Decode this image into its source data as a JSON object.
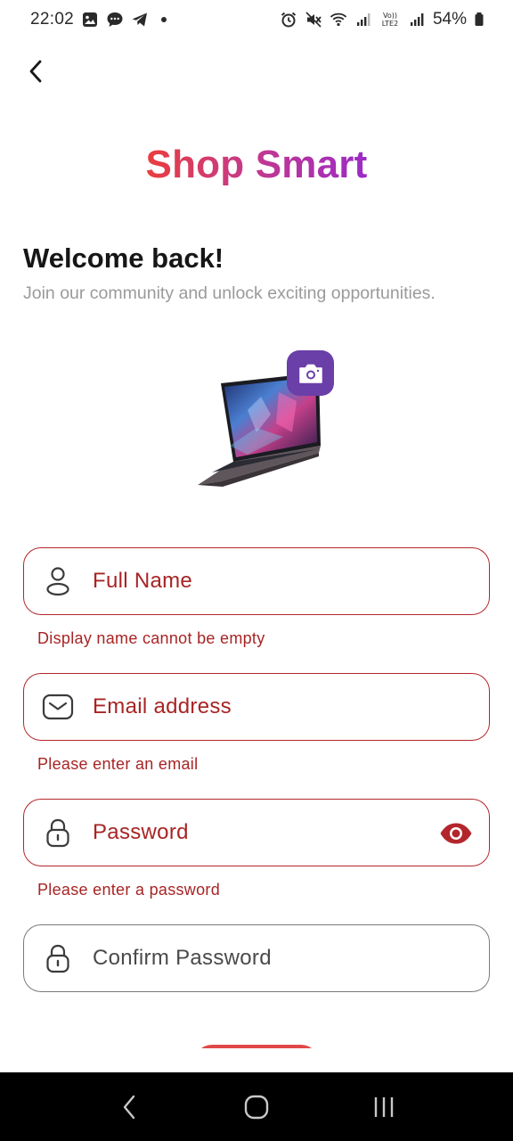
{
  "status_bar": {
    "time": "22:02",
    "left_icons": [
      "image-icon",
      "chat-icon",
      "telegram-icon"
    ],
    "right_icons": [
      "alarm-icon",
      "mute-icon",
      "wifi-icon",
      "signal-icon",
      "volte-icon",
      "signal-icon"
    ],
    "volte_label_top": "Vo))",
    "volte_label_bottom": "LTE2",
    "battery": "54%"
  },
  "header": {
    "back_icon": "chevron-left-icon"
  },
  "brand": {
    "title": "Shop Smart",
    "gradient_start": "#ea3d3d",
    "gradient_end": "#9b2bc6"
  },
  "intro": {
    "heading": "Welcome back!",
    "subtitle": "Join our community and unlock exciting opportunities."
  },
  "product": {
    "image": "laptop-image",
    "camera_icon": "camera-icon",
    "camera_bg": "#6a3fa8"
  },
  "form": {
    "full_name": {
      "placeholder": "Full Name",
      "icon": "person-icon",
      "error": "Display name cannot be empty"
    },
    "email": {
      "placeholder": "Email address",
      "icon": "mail-icon",
      "error": "Please enter an email"
    },
    "password": {
      "placeholder": "Password",
      "icon": "lock-icon",
      "toggle_icon": "eye-icon",
      "error": "Please enter a password"
    },
    "confirm_password": {
      "placeholder": "Confirm Password",
      "icon": "lock-icon"
    },
    "error_color": "#a82424"
  },
  "nav_bar": {
    "back_icon": "nav-back-icon",
    "home_icon": "nav-home-icon",
    "recents_icon": "nav-recents-icon"
  }
}
